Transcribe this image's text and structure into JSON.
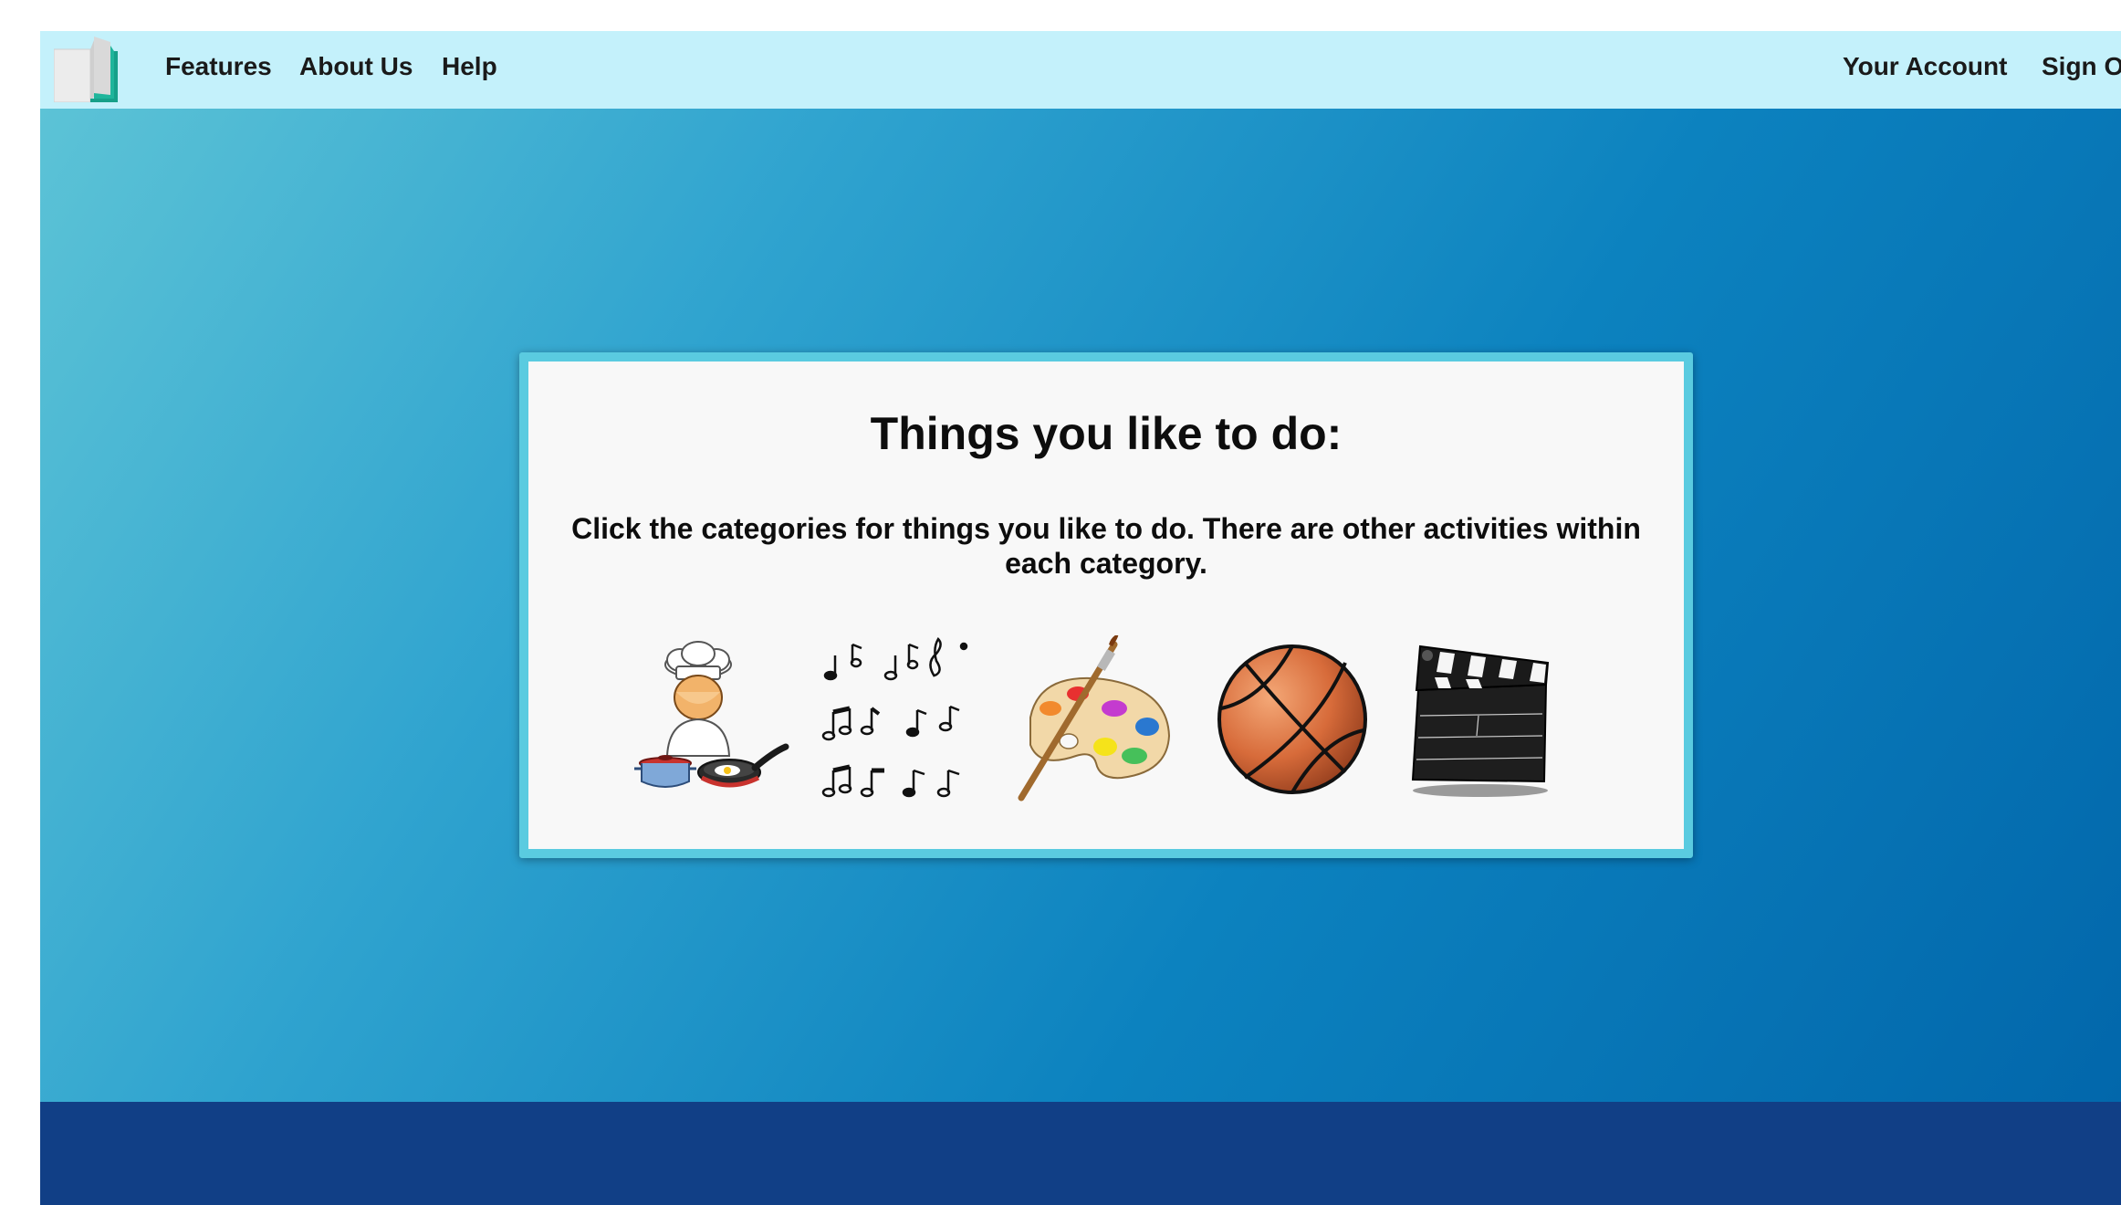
{
  "nav": {
    "left": [
      "Features",
      "About Us",
      "Help"
    ],
    "right": [
      "Your Account",
      "Sign O"
    ]
  },
  "card": {
    "title": "Things you like to do:",
    "instructions": "Click the categories for things you like to do. There are other activities within each category."
  },
  "categories": [
    {
      "icon": "chef-cooking-icon"
    },
    {
      "icon": "music-notes-icon"
    },
    {
      "icon": "paint-palette-icon"
    },
    {
      "icon": "basketball-icon"
    },
    {
      "icon": "film-clapperboard-icon"
    }
  ],
  "colors": {
    "nav_background": "#c4f1fb",
    "card_border": "#5acbe0",
    "footer_background": "#113f86",
    "hero_gradient_start": "#5cc3d6",
    "hero_gradient_end": "#0267ab"
  }
}
